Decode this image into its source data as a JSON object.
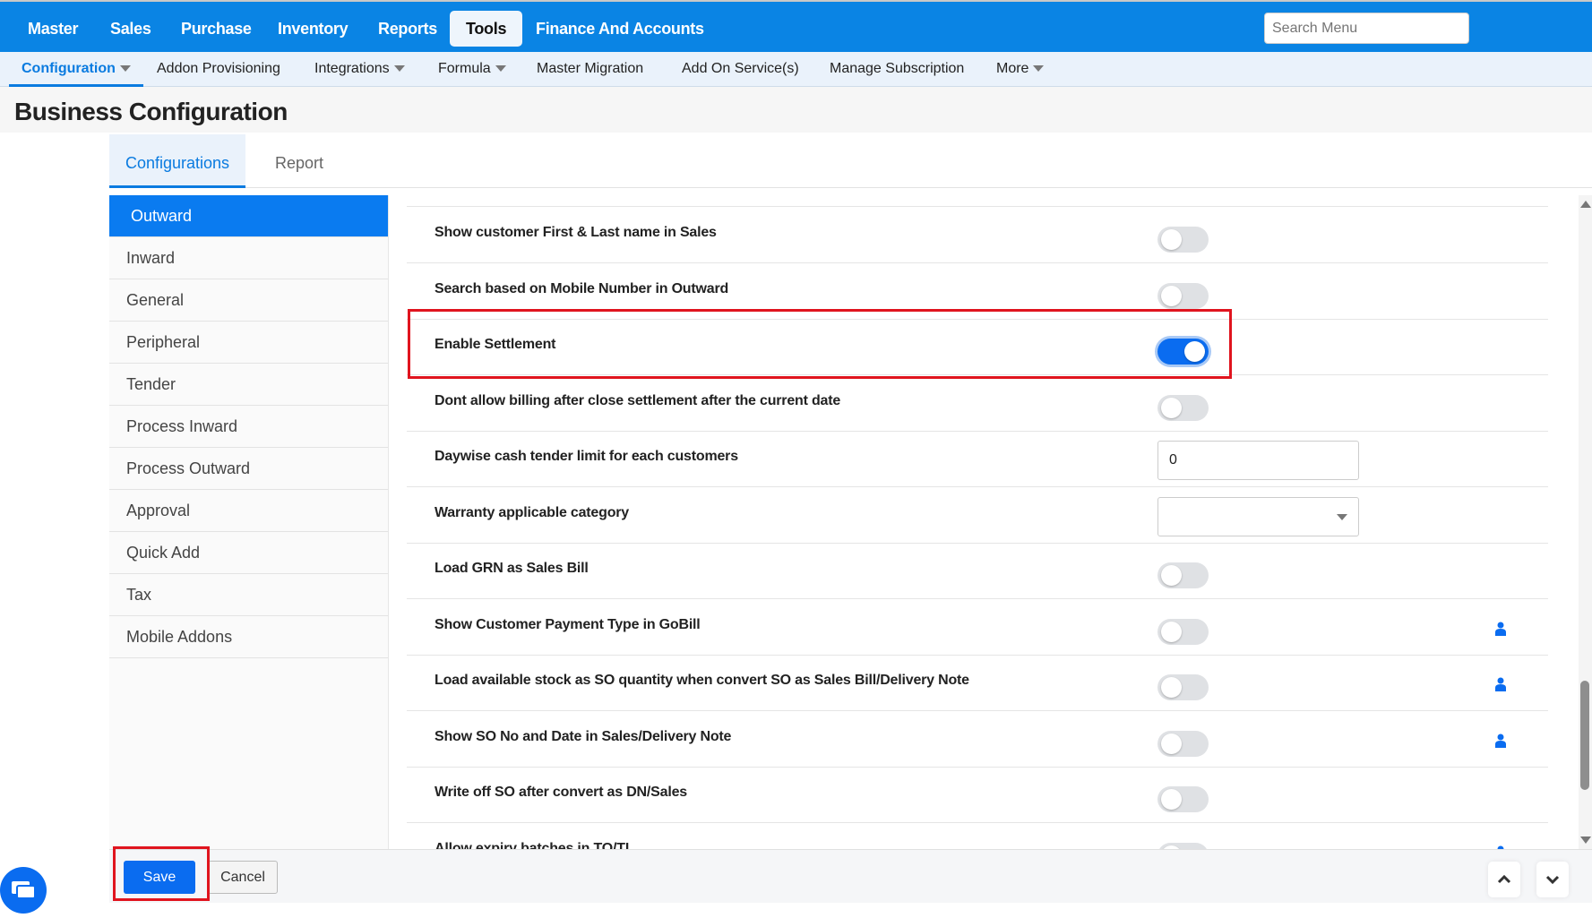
{
  "topnav": {
    "items": [
      {
        "label": "Master",
        "active": false
      },
      {
        "label": "Sales",
        "active": false
      },
      {
        "label": "Purchase",
        "active": false
      },
      {
        "label": "Inventory",
        "active": false
      },
      {
        "label": "Reports",
        "active": false
      },
      {
        "label": "Tools",
        "active": true
      },
      {
        "label": "Finance And Accounts",
        "active": false
      }
    ],
    "search_placeholder": "Search Menu"
  },
  "subnav": {
    "items": [
      {
        "label": "Configuration",
        "dropdown": true,
        "active": true
      },
      {
        "label": "Addon Provisioning"
      },
      {
        "label": "Integrations",
        "dropdown": true
      },
      {
        "label": "Formula",
        "dropdown": true
      },
      {
        "label": "Master Migration"
      },
      {
        "label": "Add On Service(s)"
      },
      {
        "label": "Manage Subscription"
      },
      {
        "label": "More",
        "dropdown": true
      }
    ]
  },
  "page_title": "Business Configuration",
  "tabs": [
    {
      "label": "Configurations",
      "active": true
    },
    {
      "label": "Report"
    }
  ],
  "sidebar": {
    "items": [
      {
        "label": "Outward",
        "active": true
      },
      {
        "label": "Inward"
      },
      {
        "label": "General"
      },
      {
        "label": "Peripheral"
      },
      {
        "label": "Tender"
      },
      {
        "label": "Process Inward"
      },
      {
        "label": "Process Outward"
      },
      {
        "label": "Approval"
      },
      {
        "label": "Quick Add"
      },
      {
        "label": "Tax"
      },
      {
        "label": "Mobile Addons"
      }
    ]
  },
  "settings": [
    {
      "label": "Show customer First & Last name in Sales",
      "type": "toggle",
      "on": false
    },
    {
      "label": "Search based on Mobile Number in Outward",
      "type": "toggle",
      "on": false
    },
    {
      "label": "Enable Settlement",
      "type": "toggle",
      "on": true,
      "highlighted": true
    },
    {
      "label": "Dont allow billing after close settlement after the current date",
      "type": "toggle",
      "on": false
    },
    {
      "label": "Daywise cash tender limit for each customers",
      "type": "text",
      "value": "0"
    },
    {
      "label": "Warranty applicable category",
      "type": "select",
      "value": ""
    },
    {
      "label": "Load GRN as Sales Bill",
      "type": "toggle",
      "on": false
    },
    {
      "label": "Show Customer Payment Type in GoBill",
      "type": "toggle",
      "on": false,
      "user_icon": true
    },
    {
      "label": "Load available stock as SO quantity when convert SO as Sales Bill/Delivery Note",
      "type": "toggle",
      "on": false,
      "user_icon": true
    },
    {
      "label": "Show SO No and Date in Sales/Delivery Note",
      "type": "toggle",
      "on": false,
      "user_icon": true
    },
    {
      "label": "Write off SO after convert as DN/Sales",
      "type": "toggle",
      "on": false
    },
    {
      "label": "Allow expiry batches in TO/TI",
      "type": "toggle",
      "on": false,
      "user_icon": true
    }
  ],
  "footer": {
    "save_label": "Save",
    "cancel_label": "Cancel"
  },
  "colors": {
    "primary": "#0a84e4",
    "accent": "#0a6cf0",
    "highlight": "#e0141e"
  }
}
